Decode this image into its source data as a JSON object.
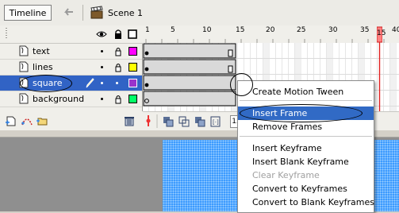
{
  "toolbar": {
    "timeline_label": "Timeline",
    "scene_label": "Scene 1"
  },
  "timeline": {
    "ruler": [
      "1",
      "5",
      "10",
      "15",
      "20",
      "25",
      "30",
      "35",
      "40"
    ],
    "current_frame": "15",
    "layers": [
      {
        "name": "text",
        "color": "#ff00ff"
      },
      {
        "name": "lines",
        "color": "#ffff00"
      },
      {
        "name": "square",
        "color": "#9933cc"
      },
      {
        "name": "background",
        "color": "#00ff66"
      }
    ]
  },
  "context_menu": {
    "items": [
      {
        "label": "Create Motion Tween",
        "state": "normal"
      },
      {
        "label": "Insert Frame",
        "state": "highlighted"
      },
      {
        "label": "Remove Frames",
        "state": "normal"
      },
      {
        "label": "Insert Keyframe",
        "state": "normal"
      },
      {
        "label": "Insert Blank Keyframe",
        "state": "normal"
      },
      {
        "label": "Clear Keyframe",
        "state": "disabled"
      },
      {
        "label": "Convert to Keyframes",
        "state": "normal"
      },
      {
        "label": "Convert to Blank Keyframes",
        "state": "normal"
      }
    ]
  },
  "colors": {
    "selection": "#3163c5",
    "menu_highlight": "#316ac5",
    "playhead": "#ff4d4d",
    "stage_fill": "#3d9bff"
  }
}
